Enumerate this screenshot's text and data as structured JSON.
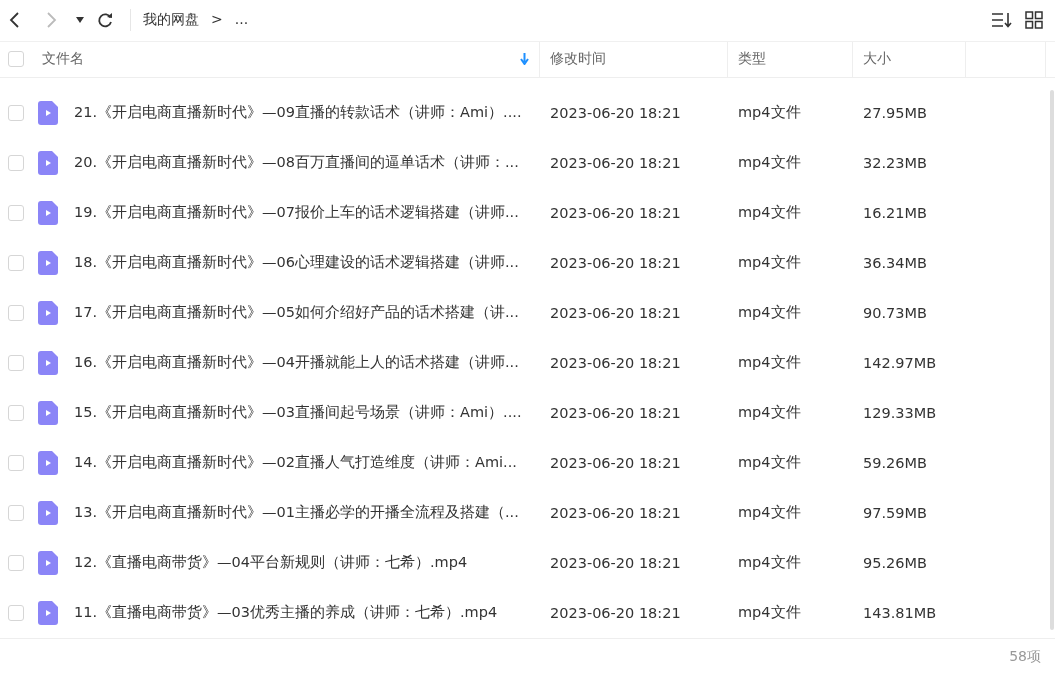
{
  "toolbar": {
    "breadcrumb": [
      "我的网盘",
      ">",
      "..."
    ]
  },
  "table": {
    "select_all": {
      "checked": false
    },
    "columns": [
      {
        "label": "文件名",
        "sorted": true
      },
      {
        "label": "修改时间",
        "sorted": false
      },
      {
        "label": "类型",
        "sorted": false
      },
      {
        "label": "大小",
        "sorted": false
      }
    ],
    "rows": [
      {
        "checked": false,
        "name": "21.《开启电商直播新时代》—09直播的转款话术（讲师：Ami）....",
        "modified": "2023-06-20 18:21",
        "type": "mp4文件",
        "size": "27.95MB"
      },
      {
        "checked": false,
        "name": "20.《开启电商直播新时代》—08百万直播间的逼单话术（讲师：...",
        "modified": "2023-06-20 18:21",
        "type": "mp4文件",
        "size": "32.23MB"
      },
      {
        "checked": false,
        "name": "19.《开启电商直播新时代》—07报价上车的话术逻辑搭建（讲师...",
        "modified": "2023-06-20 18:21",
        "type": "mp4文件",
        "size": "16.21MB"
      },
      {
        "checked": false,
        "name": "18.《开启电商直播新时代》—06心理建设的话术逻辑搭建（讲师...",
        "modified": "2023-06-20 18:21",
        "type": "mp4文件",
        "size": "36.34MB"
      },
      {
        "checked": false,
        "name": "17.《开启电商直播新时代》—05如何介绍好产品的话术搭建（讲...",
        "modified": "2023-06-20 18:21",
        "type": "mp4文件",
        "size": "90.73MB"
      },
      {
        "checked": false,
        "name": "16.《开启电商直播新时代》—04开播就能上人的话术搭建（讲师...",
        "modified": "2023-06-20 18:21",
        "type": "mp4文件",
        "size": "142.97MB"
      },
      {
        "checked": false,
        "name": "15.《开启电商直播新时代》—03直播间起号场景（讲师：Ami）....",
        "modified": "2023-06-20 18:21",
        "type": "mp4文件",
        "size": "129.33MB"
      },
      {
        "checked": false,
        "name": "14.《开启电商直播新时代》—02直播人气打造维度（讲师：Ami...",
        "modified": "2023-06-20 18:21",
        "type": "mp4文件",
        "size": "59.26MB"
      },
      {
        "checked": false,
        "name": "13.《开启电商直播新时代》—01主播必学的开播全流程及搭建（...",
        "modified": "2023-06-20 18:21",
        "type": "mp4文件",
        "size": "97.59MB"
      },
      {
        "checked": false,
        "name": "12.《直播电商带货》—04平台新规则（讲师：七希）.mp4",
        "modified": "2023-06-20 18:21",
        "type": "mp4文件",
        "size": "95.26MB"
      },
      {
        "checked": false,
        "name": "11.《直播电商带货》—03优秀主播的养成（讲师：七希）.mp4",
        "modified": "2023-06-20 18:21",
        "type": "mp4文件",
        "size": "143.81MB"
      }
    ]
  },
  "status_bar": {
    "count": "58项"
  }
}
